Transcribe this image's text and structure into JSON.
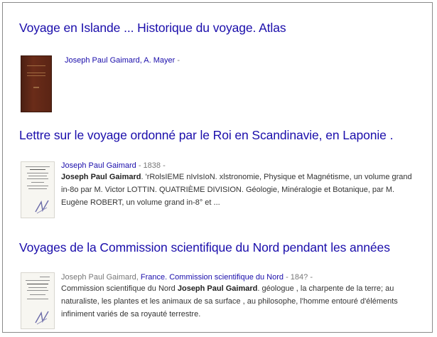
{
  "results": [
    {
      "title": "Voyage en Islande ... Historique du voyage. Atlas",
      "authors": "Joseph Paul Gaimard, A. Mayer",
      "meta_suffix": " -",
      "thumbnail_icon": "book-cover-icon"
    },
    {
      "title": "Lettre sur le voyage ordonné par le Roi en Scandinavie, en Laponie .",
      "authors": "Joseph Paul Gaimard",
      "meta_suffix": " - 1838 -",
      "snippet_bold": "Joseph Paul Gaimard",
      "snippet_rest": ". 'rRolsIEME nIvIsIoN. xlstronomie, Physique et Magnétisme, un volume grand in-8o par M. Victor LOTTIN. QUATRIÈME DIVISION. Géologie, Minéralogie et Botanique, par M. Eugène ROBERT, un volume grand in-8° et ...",
      "thumbnail_icon": "document-page-icon"
    },
    {
      "title": "Voyages de la Commission scientifique du Nord pendant les années",
      "authors_plain": "Joseph Paul Gaimard, ",
      "authors_link": "France. Commission scientifique du Nord",
      "meta_suffix": " - 184? -",
      "snippet_pre": "Commission scientifique du Nord ",
      "snippet_bold": "Joseph Paul Gaimard",
      "snippet_rest": ". géologue , la charpente de la terre; au naturaliste, les plantes et les animaux de sa surface , au philosophe, l'homme entouré d'éléments infiniment variés de sa royauté terrestre.",
      "thumbnail_icon": "document-page-icon"
    }
  ],
  "colors": {
    "link": "#1a0dab",
    "meta": "#777777",
    "text": "#333333",
    "border": "#8a8a8a"
  }
}
